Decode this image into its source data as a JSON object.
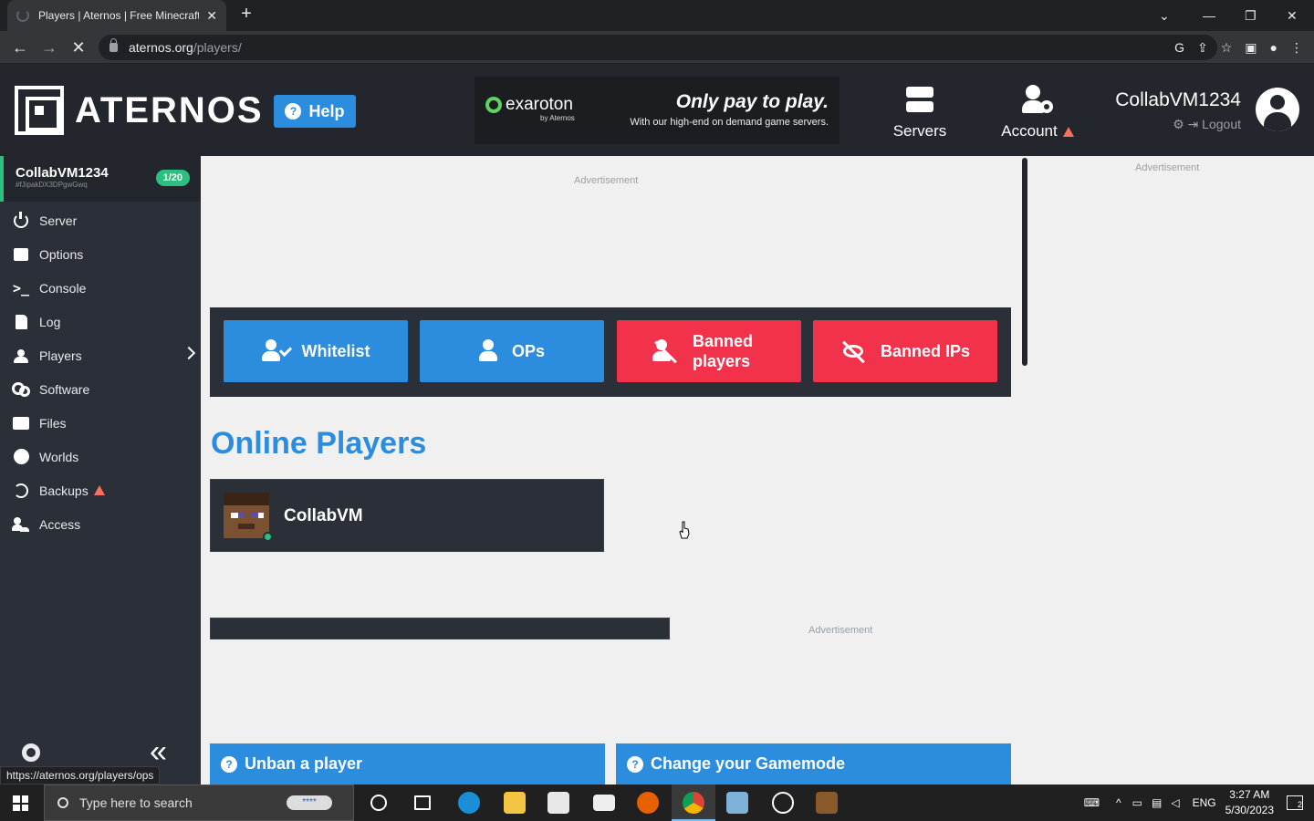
{
  "browser": {
    "tab_title": "Players | Aternos | Free Minecraft",
    "tab_close": "✕",
    "new_tab": "+",
    "url_host": "aternos.org",
    "url_path": "/players/",
    "status_url": "https://aternos.org/players/ops",
    "window_controls": [
      "⌄",
      "—",
      "❐",
      "✕"
    ]
  },
  "header": {
    "logo_text": "ATERNOS",
    "help_label": "Help",
    "banner": {
      "brand": "exaroton",
      "brand_sub": "by Aternos",
      "headline": "Only pay to play.",
      "subline": "With our high-end on demand game servers."
    },
    "nav": {
      "servers_label": "Servers",
      "account_label": "Account"
    },
    "user": {
      "name": "CollabVM1234",
      "logout_label": "Logout"
    }
  },
  "sidebar": {
    "server_name": "CollabVM1234",
    "server_id": "#fJipakDX3DPgwGwq",
    "player_count": "1/20",
    "items": [
      {
        "label": "Server",
        "icon": "power-icon"
      },
      {
        "label": "Options",
        "icon": "options-icon"
      },
      {
        "label": "Console",
        "icon": "terminal-icon"
      },
      {
        "label": "Log",
        "icon": "file-icon"
      },
      {
        "label": "Players",
        "icon": "users-icon"
      },
      {
        "label": "Software",
        "icon": "cogs-icon"
      },
      {
        "label": "Files",
        "icon": "folder-icon"
      },
      {
        "label": "Worlds",
        "icon": "globe-icon"
      },
      {
        "label": "Backups",
        "icon": "history-icon"
      },
      {
        "label": "Access",
        "icon": "user-lock-icon"
      }
    ],
    "console_glyph": ">_",
    "collapse_glyph": "«"
  },
  "main": {
    "ad_label": "Advertisement",
    "lists": [
      {
        "label": "Whitelist",
        "color": "#2c8dde"
      },
      {
        "label": "OPs",
        "color": "#2c8dde"
      },
      {
        "label": "Banned players",
        "color": "#f2314b"
      },
      {
        "label": "Banned IPs",
        "color": "#f2314b"
      }
    ],
    "online_title": "Online Players",
    "players": [
      {
        "name": "CollabVM",
        "online": true
      }
    ],
    "faq": [
      {
        "label": "Unban a player"
      },
      {
        "label": "Change your Gamemode"
      }
    ],
    "faq_glyph": "?"
  },
  "taskbar": {
    "search_placeholder": "Type here to search",
    "password_badge": "****",
    "language": "ENG",
    "time": "3:27 AM",
    "date": "5/30/2023",
    "notification_count": "2"
  },
  "colors": {
    "accent_blue": "#2c8dde",
    "danger_red": "#f2314b",
    "online_green": "#2bc07f",
    "header_dark": "#23272d"
  }
}
